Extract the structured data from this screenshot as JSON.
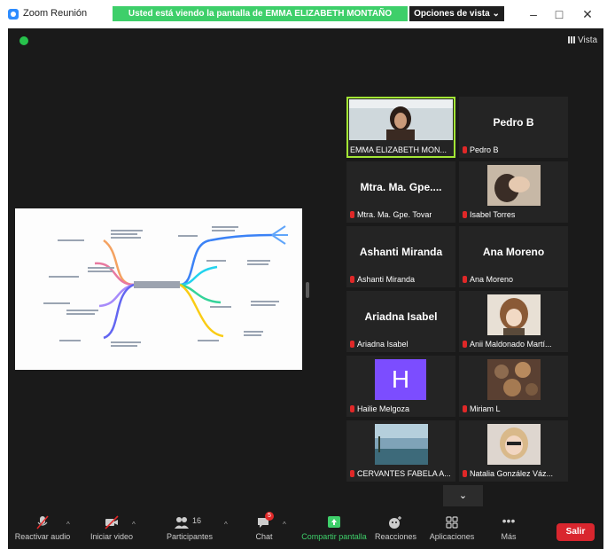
{
  "window": {
    "title": "Zoom Reunión",
    "share_banner": "Usted está viendo la pantalla de EMMA ELIZABETH MONTAÑO GOMEZ",
    "view_options": "Opciones de vista",
    "vista_label": "Vista"
  },
  "participants": [
    {
      "id": "emma",
      "label": "EMMA ELIZABETH MON...",
      "type": "video"
    },
    {
      "id": "pedro",
      "big_name": "Pedro B",
      "label": "Pedro B",
      "type": "name"
    },
    {
      "id": "tovar",
      "big_name": "Mtra. Ma. Gpe....",
      "label": "Mtra. Ma. Gpe. Tovar",
      "type": "name"
    },
    {
      "id": "isabel",
      "label": "Isabel Torres",
      "type": "photo"
    },
    {
      "id": "ashanti",
      "big_name": "Ashanti Miranda",
      "label": "Ashanti Miranda",
      "type": "name"
    },
    {
      "id": "ana",
      "big_name": "Ana Moreno",
      "label": "Ana Moreno",
      "type": "name"
    },
    {
      "id": "ariadna",
      "big_name": "Ariadna Isabel",
      "label": "Ariadna Isabel",
      "type": "name"
    },
    {
      "id": "anii",
      "label": "Anii Maldonado Martí...",
      "type": "photo"
    },
    {
      "id": "hailie",
      "avatar_letter": "H",
      "label": "Hailie Melgoza",
      "type": "avatar"
    },
    {
      "id": "miriam",
      "label": "Miriam L",
      "type": "photo"
    },
    {
      "id": "cervantes",
      "label": "CERVANTES FABELA A...",
      "type": "photo"
    },
    {
      "id": "natalia",
      "label": "Natalia González Váz...",
      "type": "photo"
    }
  ],
  "toolbar": {
    "audio": "Reactivar audio",
    "video": "Iniciar video",
    "participants": "Participantes",
    "participants_count": "16",
    "chat": "Chat",
    "chat_badge": "5",
    "share": "Compartir pantalla",
    "reactions": "Reacciones",
    "apps": "Aplicaciones",
    "more": "Más",
    "leave": "Salir"
  },
  "colors": {
    "banner": "#3ecf6a",
    "active_speaker": "#a3e635",
    "leave": "#d9262e",
    "avatar_h": "#7c4dff"
  }
}
